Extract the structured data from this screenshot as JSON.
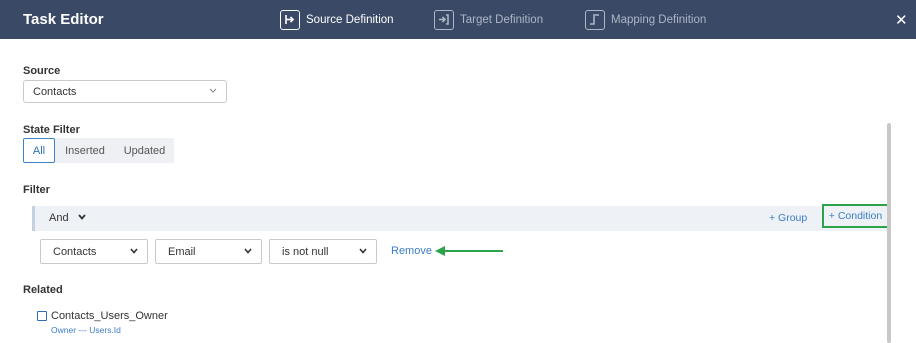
{
  "header": {
    "title": "Task Editor",
    "tabs": [
      {
        "label": "Source Definition",
        "active": true,
        "icon": "source-definition-icon"
      },
      {
        "label": "Target Definition",
        "active": false,
        "icon": "target-definition-icon"
      },
      {
        "label": "Mapping Definition",
        "active": false,
        "icon": "mapping-definition-icon"
      }
    ],
    "close_glyph": "✕"
  },
  "source": {
    "label": "Source",
    "value": "Contacts"
  },
  "state_filter": {
    "label": "State Filter",
    "options": [
      "All",
      "Inserted",
      "Updated"
    ],
    "selected": "All"
  },
  "filter": {
    "label": "Filter",
    "operator": "And",
    "group_link": "+ Group",
    "condition_button": "+ Condition",
    "condition": {
      "object": "Contacts",
      "field": "Email",
      "op": "is not null",
      "remove_label": "Remove"
    }
  },
  "related": {
    "label": "Related",
    "items": [
      {
        "name": "Contacts_Users_Owner",
        "mapping": "Owner --- Users.Id",
        "checked": false
      }
    ]
  },
  "colors": {
    "header_bg": "#3a4966",
    "accent": "#3a7cc3",
    "highlight_green": "#2aa34a"
  }
}
